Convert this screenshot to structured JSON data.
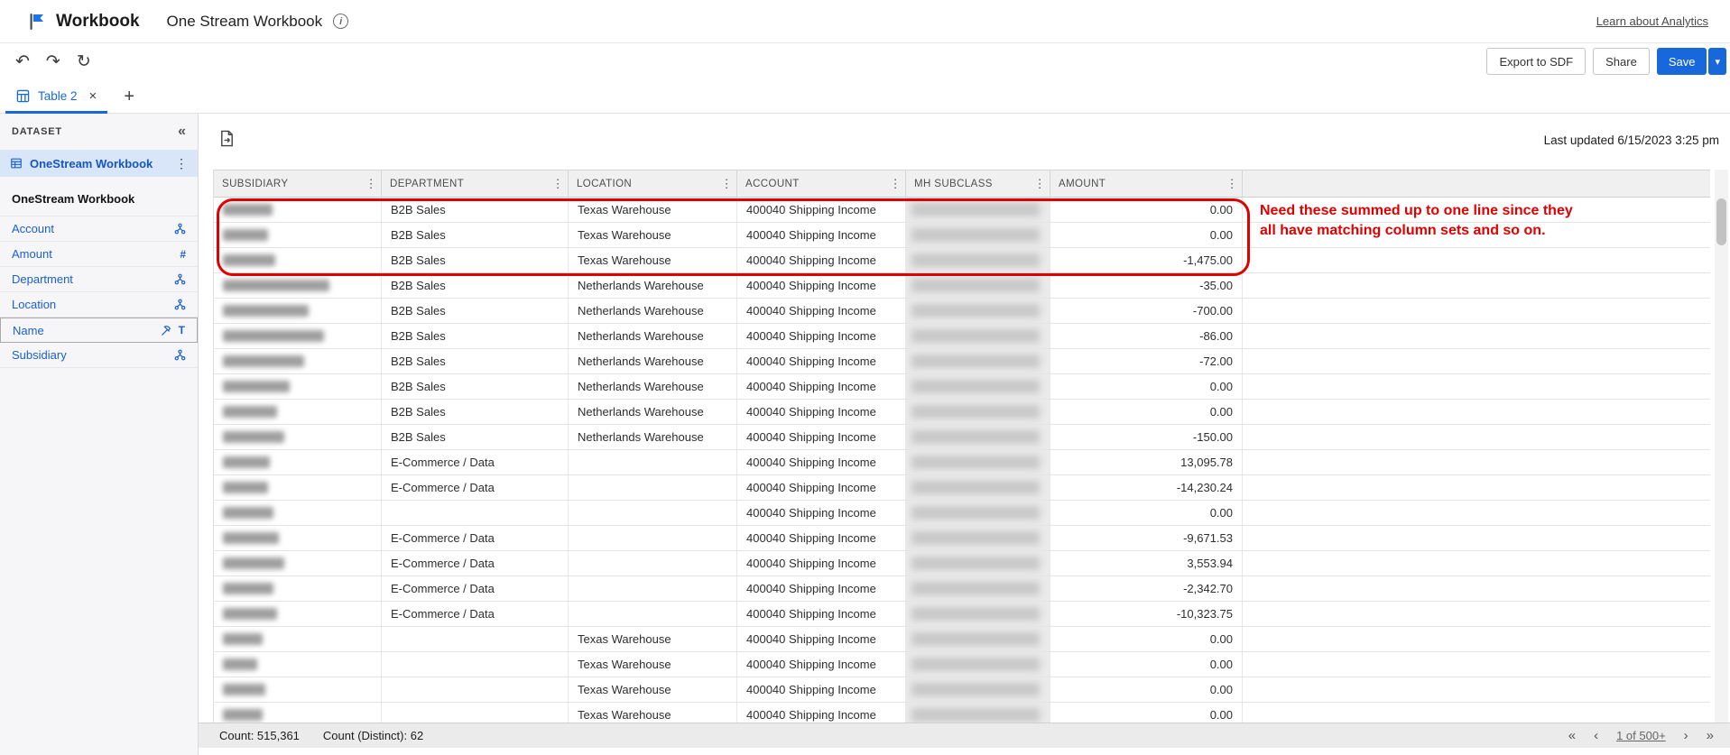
{
  "header": {
    "app_name": "Workbook",
    "workbook_title": "One Stream Workbook",
    "learn_link": "Learn about Analytics"
  },
  "toolbar": {
    "export_label": "Export to SDF",
    "share_label": "Share",
    "save_label": "Save"
  },
  "tabbar": {
    "active_tab_label": "Table 2"
  },
  "sidebar": {
    "panel_title": "DATASET",
    "dataset_name": "OneStream Workbook",
    "section_title": "OneStream Workbook",
    "fields": [
      {
        "label": "Account",
        "type": "hierarchy"
      },
      {
        "label": "Amount",
        "type": "number"
      },
      {
        "label": "Department",
        "type": "hierarchy"
      },
      {
        "label": "Location",
        "type": "hierarchy"
      },
      {
        "label": "Name",
        "type": "formula-text"
      },
      {
        "label": "Subsidiary",
        "type": "hierarchy"
      }
    ]
  },
  "icons": {
    "info": "i",
    "undo": "↶",
    "redo": "↷",
    "refresh": "↻",
    "close": "×",
    "add": "+",
    "kebab": "⋮",
    "collapse": "«",
    "save_caret": "▾",
    "number_type": "#",
    "text_type": "T",
    "first_page": "«",
    "prev_page": "‹",
    "next_page": "›",
    "last_page": "»"
  },
  "colors": {
    "accent_blue": "#1868db",
    "annotation_red": "#e00000",
    "selected_dataset_bg": "#d9e6f9"
  },
  "main": {
    "last_updated": "Last updated 6/15/2023 3:25 pm",
    "annotation": {
      "line1": "Need these summed up to one line since they",
      "line2": "all have matching column sets and so on."
    },
    "table": {
      "columns": [
        "SUBSIDIARY",
        "DEPARTMENT",
        "LOCATION",
        "ACCOUNT",
        "MH SUBCLASS",
        "AMOUNT"
      ],
      "rows": [
        {
          "department": "B2B Sales",
          "location": "Texas Warehouse",
          "account": "400040 Shipping Income",
          "amount": "0.00",
          "redact_w": 55
        },
        {
          "department": "B2B Sales",
          "location": "Texas Warehouse",
          "account": "400040 Shipping Income",
          "amount": "0.00",
          "redact_w": 50
        },
        {
          "department": "B2B Sales",
          "location": "Texas Warehouse",
          "account": "400040 Shipping Income",
          "amount": "-1,475.00",
          "redact_w": 58
        },
        {
          "department": "B2B Sales",
          "location": "Netherlands Warehouse",
          "account": "400040 Shipping Income",
          "amount": "-35.00",
          "redact_w": 118
        },
        {
          "department": "B2B Sales",
          "location": "Netherlands Warehouse",
          "account": "400040 Shipping Income",
          "amount": "-700.00",
          "redact_w": 95
        },
        {
          "department": "B2B Sales",
          "location": "Netherlands Warehouse",
          "account": "400040 Shipping Income",
          "amount": "-86.00",
          "redact_w": 112
        },
        {
          "department": "B2B Sales",
          "location": "Netherlands Warehouse",
          "account": "400040 Shipping Income",
          "amount": "-72.00",
          "redact_w": 90
        },
        {
          "department": "B2B Sales",
          "location": "Netherlands Warehouse",
          "account": "400040 Shipping Income",
          "amount": "0.00",
          "redact_w": 74
        },
        {
          "department": "B2B Sales",
          "location": "Netherlands Warehouse",
          "account": "400040 Shipping Income",
          "amount": "0.00",
          "redact_w": 60
        },
        {
          "department": "B2B Sales",
          "location": "Netherlands Warehouse",
          "account": "400040 Shipping Income",
          "amount": "-150.00",
          "redact_w": 68
        },
        {
          "department": "E-Commerce / Data",
          "location": "",
          "account": "400040 Shipping Income",
          "amount": "13,095.78",
          "redact_w": 52
        },
        {
          "department": "E-Commerce / Data",
          "location": "",
          "account": "400040 Shipping Income",
          "amount": "-14,230.24",
          "redact_w": 50
        },
        {
          "department": "",
          "location": "",
          "account": "400040 Shipping Income",
          "amount": "0.00",
          "redact_w": 56
        },
        {
          "department": "E-Commerce / Data",
          "location": "",
          "account": "400040 Shipping Income",
          "amount": "-9,671.53",
          "redact_w": 62
        },
        {
          "department": "E-Commerce / Data",
          "location": "",
          "account": "400040 Shipping Income",
          "amount": "3,553.94",
          "redact_w": 68
        },
        {
          "department": "E-Commerce / Data",
          "location": "",
          "account": "400040 Shipping Income",
          "amount": "-2,342.70",
          "redact_w": 56
        },
        {
          "department": "E-Commerce / Data",
          "location": "",
          "account": "400040 Shipping Income",
          "amount": "-10,323.75",
          "redact_w": 60
        },
        {
          "department": "",
          "location": "Texas Warehouse",
          "account": "400040 Shipping Income",
          "amount": "0.00",
          "redact_w": 44
        },
        {
          "department": "",
          "location": "Texas Warehouse",
          "account": "400040 Shipping Income",
          "amount": "0.00",
          "redact_w": 38
        },
        {
          "department": "",
          "location": "Texas Warehouse",
          "account": "400040 Shipping Income",
          "amount": "0.00",
          "redact_w": 47
        },
        {
          "department": "",
          "location": "Texas Warehouse",
          "account": "400040 Shipping Income",
          "amount": "0.00",
          "redact_w": 44
        }
      ]
    },
    "status": {
      "count": "Count: 515,361",
      "count_distinct": "Count (Distinct): 62",
      "page": "1 of 500+"
    }
  }
}
